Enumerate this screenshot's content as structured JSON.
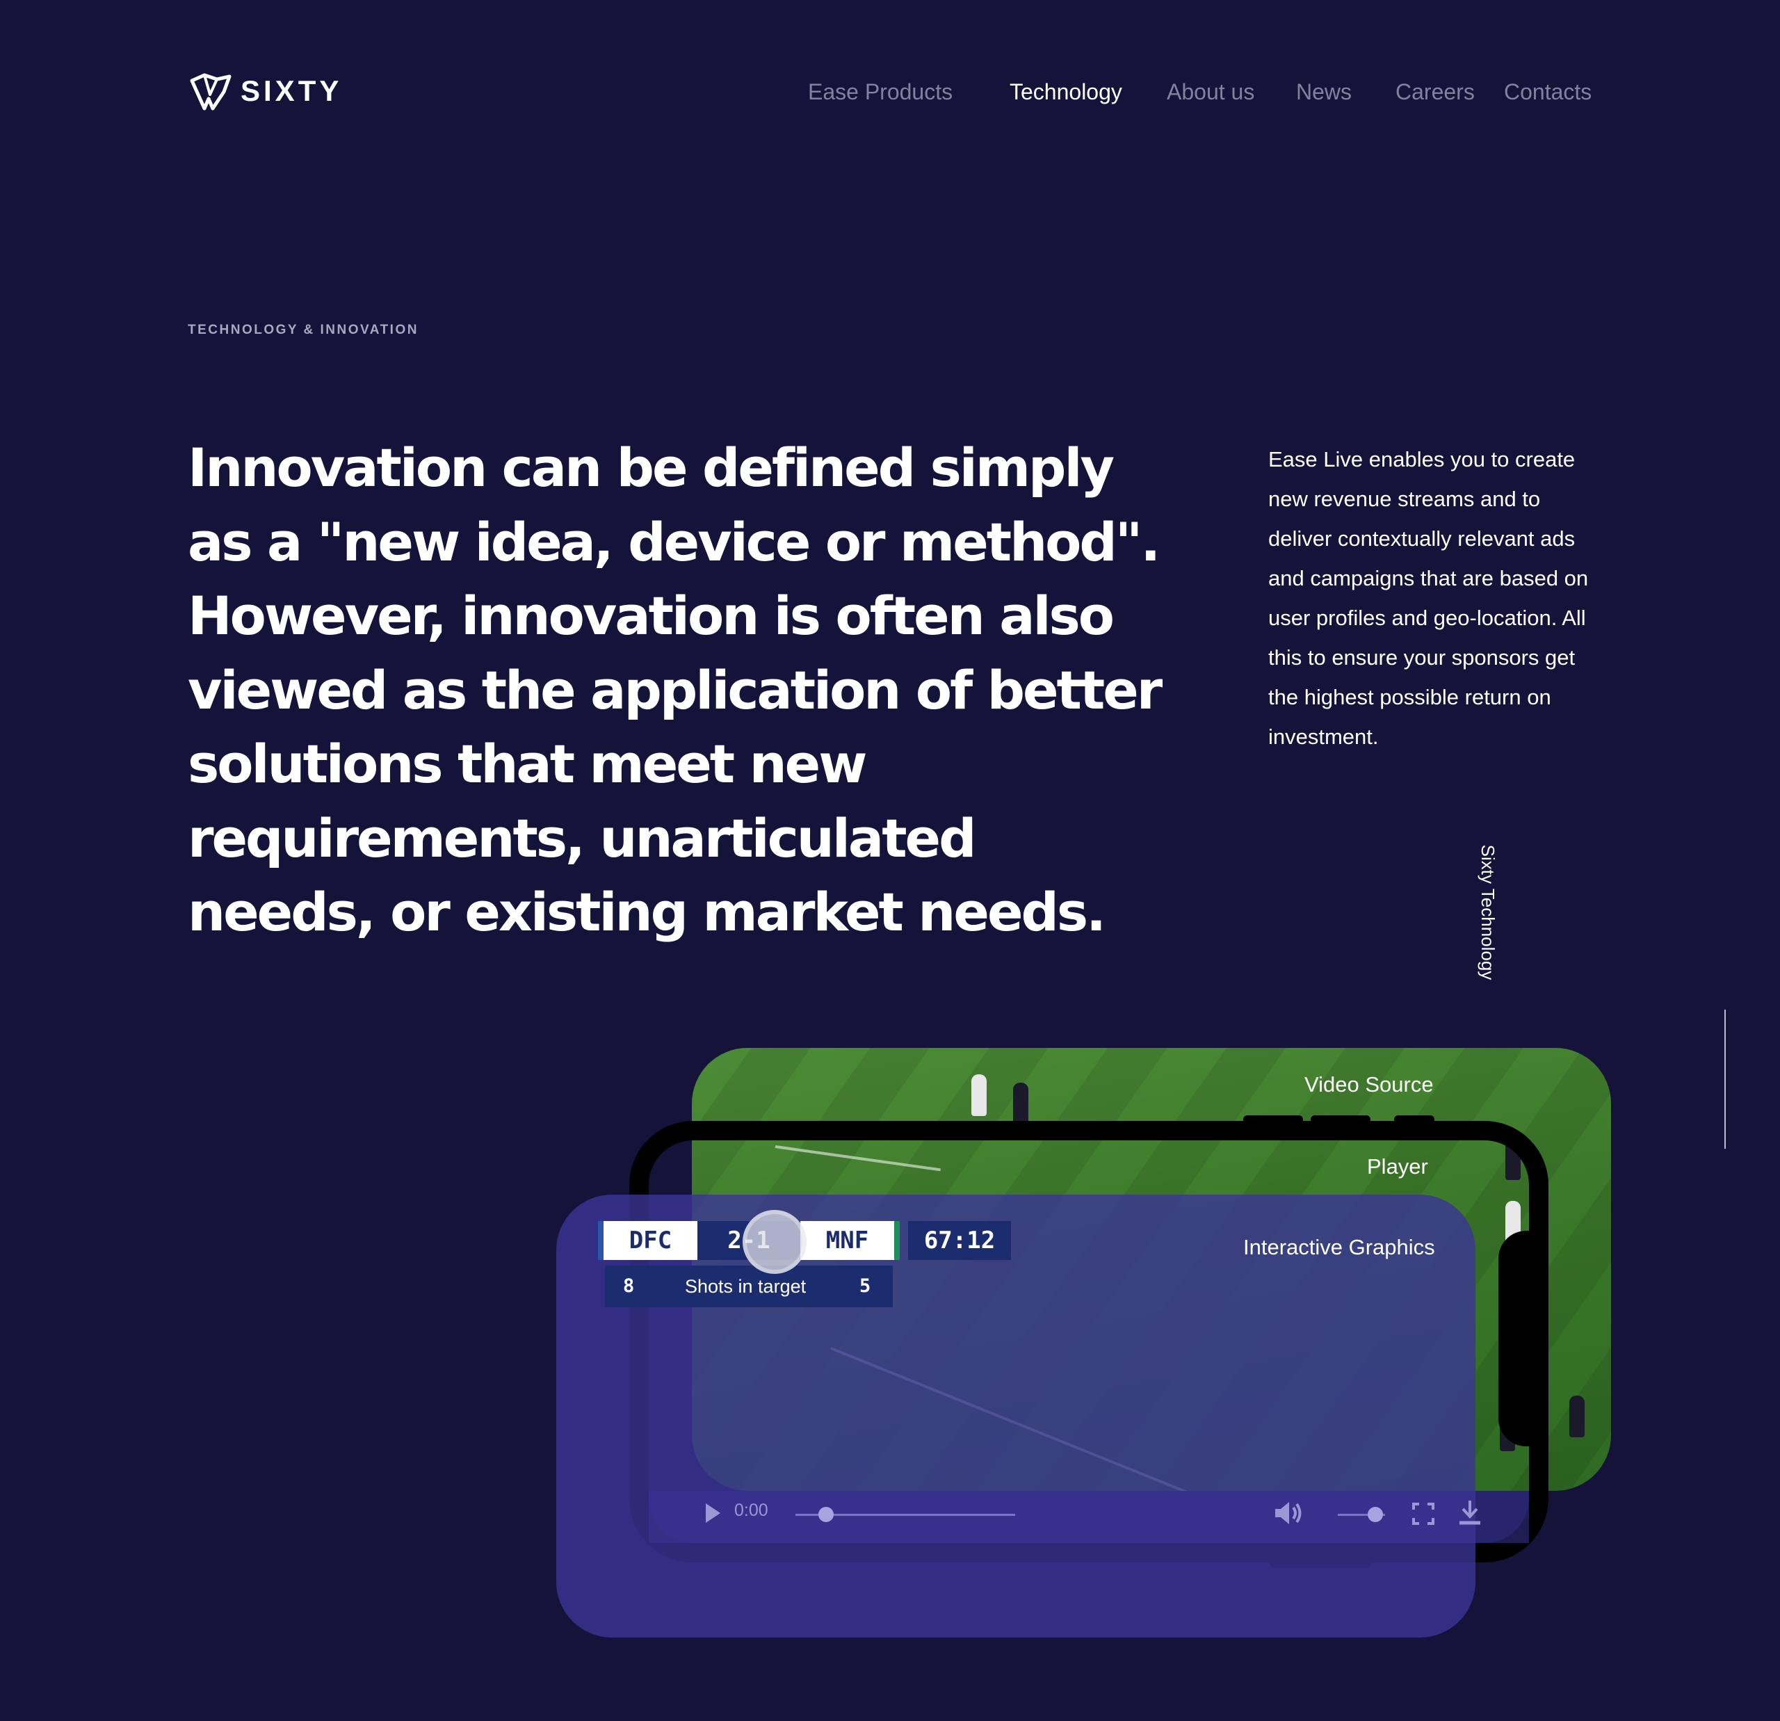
{
  "brand": {
    "name": "SIXTY"
  },
  "nav": [
    {
      "label": "Ease Products",
      "active": false
    },
    {
      "label": "Technology",
      "active": true
    },
    {
      "label": "About us",
      "active": false
    },
    {
      "label": "News",
      "active": false
    },
    {
      "label": "Careers",
      "active": false
    },
    {
      "label": "Contacts",
      "active": false
    }
  ],
  "hero": {
    "eyebrow": "TECHNOLOGY & INNOVATION",
    "headline": "Innovation can be defined simply as a \"new idea, device or method\". However, innovation is often also viewed as the application of better solutions that meet new requirements, unarticulated needs, or existing market needs.",
    "aside": "Ease Live enables you to create new revenue streams and to deliver contextually relevant ads and campaigns that are based on user profiles and geo-location. All this to ensure your sponsors get the highest possible return on investment."
  },
  "side_label": "Sixty Technology",
  "illustration": {
    "layers": {
      "video_source": "Video Source",
      "player": "Player",
      "interactive_graphics": "Interactive Graphics"
    },
    "scoreboard": {
      "home_team": "DFC",
      "score": "2-1",
      "away_team": "MNF",
      "match_time": "67:12",
      "stat_home": "8",
      "stat_label": "Shots in target",
      "stat_away": "5"
    },
    "player_controls": {
      "time": "0:00",
      "progress": 0.14,
      "volume": 0.8
    }
  },
  "colors": {
    "background": "#15133a",
    "overlay": "#3b3596",
    "pitch": "#3d7a2b",
    "scoreboard_navy": "#1c2d6f"
  }
}
